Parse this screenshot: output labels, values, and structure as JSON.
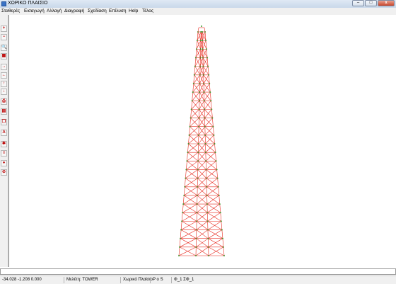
{
  "window": {
    "title": "ΧΩΡΙΚΟ ΠΛΑΙΣΙΟ",
    "minimize_glyph": "–",
    "maximize_glyph": "□",
    "close_glyph": "x"
  },
  "menu": [
    {
      "label": "Σταθερές"
    },
    {
      "label": "Εισαγωγή"
    },
    {
      "label": "Αλλαγή"
    },
    {
      "label": "Διαγραφή"
    },
    {
      "label": "Σχεδίαση"
    },
    {
      "label": "Επίλυση"
    },
    {
      "label": "Help"
    },
    {
      "label": "Τέλος"
    }
  ],
  "toolbar": [
    {
      "icon": "plus-icon",
      "glyph": "+"
    },
    {
      "icon": "minus-icon",
      "glyph": "−"
    },
    {
      "icon": "zoom-icon",
      "glyph": "🔍"
    },
    {
      "icon": "grid-icon",
      "glyph": "▦"
    },
    {
      "icon": "arrow-right-icon",
      "glyph": "→"
    },
    {
      "icon": "arrow-left-icon",
      "glyph": "←"
    },
    {
      "icon": "arrow-up-icon",
      "glyph": "↑"
    },
    {
      "icon": "arrow-down-icon",
      "glyph": "↓"
    },
    {
      "icon": "print-icon",
      "glyph": "⎙"
    },
    {
      "icon": "document-icon",
      "glyph": "▤"
    },
    {
      "icon": "copy-icon",
      "glyph": "❐"
    },
    {
      "icon": "text-icon",
      "glyph": "A"
    },
    {
      "icon": "settings-icon",
      "glyph": "✱"
    },
    {
      "icon": "chart-icon",
      "glyph": "≡"
    },
    {
      "icon": "globe-icon",
      "glyph": "●"
    },
    {
      "icon": "stop-icon",
      "glyph": "⊘"
    }
  ],
  "colors": {
    "member": "#e8281e",
    "node": "#3e9b2f"
  },
  "status": {
    "coordinates": "-34.028 -1.208 0.000",
    "project": "Μελέτη: TOWER",
    "frame_type": "Χωρικό Πλαίσιο",
    "mode": "P o S",
    "sections": "Φ_1  ΣΦ_1"
  }
}
